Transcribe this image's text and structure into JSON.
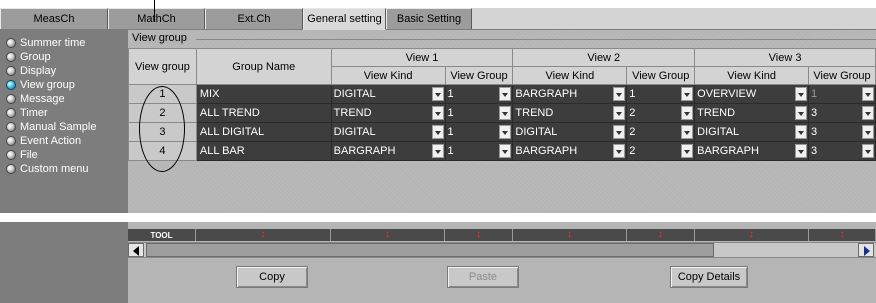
{
  "tabs": [
    {
      "label": "MeasCh",
      "active": false
    },
    {
      "label": "MathCh",
      "active": false
    },
    {
      "label": "Ext.Ch",
      "active": false
    },
    {
      "label": "General setting",
      "active": true
    },
    {
      "label": "Basic Setting",
      "active": false
    }
  ],
  "sidebar": {
    "items": [
      {
        "label": "Summer time",
        "active": false
      },
      {
        "label": "Group",
        "active": false
      },
      {
        "label": "Display",
        "active": false
      },
      {
        "label": "View group",
        "active": true
      },
      {
        "label": "Message",
        "active": false
      },
      {
        "label": "Timer",
        "active": false
      },
      {
        "label": "Manual Sample",
        "active": false
      },
      {
        "label": "Event Action",
        "active": false
      },
      {
        "label": "File",
        "active": false
      },
      {
        "label": "Custom menu",
        "active": false
      }
    ]
  },
  "main": {
    "section_label": "View group",
    "headers": {
      "view_group": "View group",
      "group_name": "Group Name",
      "view1": "View 1",
      "view2": "View 2",
      "view3": "View 3",
      "view_kind": "View Kind",
      "view_group_sub": "View Group"
    },
    "rows": [
      {
        "num": "1",
        "name": "MIX",
        "v1_kind": "DIGITAL",
        "v1_group": "1",
        "v2_kind": "BARGRAPH",
        "v2_group": "1",
        "v3_kind": "OVERVIEW",
        "v3_group": "1"
      },
      {
        "num": "2",
        "name": "ALL TREND",
        "v1_kind": "TREND",
        "v1_group": "1",
        "v2_kind": "TREND",
        "v2_group": "2",
        "v3_kind": "TREND",
        "v3_group": "3"
      },
      {
        "num": "3",
        "name": "ALL DIGITAL",
        "v1_kind": "DIGITAL",
        "v1_group": "1",
        "v2_kind": "DIGITAL",
        "v2_group": "2",
        "v3_kind": "DIGITAL",
        "v3_group": "3"
      },
      {
        "num": "4",
        "name": "ALL BAR",
        "v1_kind": "BARGRAPH",
        "v1_group": "1",
        "v2_kind": "BARGRAPH",
        "v2_group": "2",
        "v3_kind": "BARGRAPH",
        "v3_group": "3"
      }
    ]
  },
  "toolbar": {
    "tool_label": "TOOL",
    "copy_label": "Copy",
    "paste_label": "Paste",
    "copy_details_label": "Copy Details"
  },
  "colors": {
    "sidebar_bg": "#7d7d7d",
    "panel_bg": "#b5b5b5",
    "cell_bg": "#3d3d3d",
    "active_dot": "#4cc4e8",
    "tool_mark": "#ff2a2a"
  }
}
